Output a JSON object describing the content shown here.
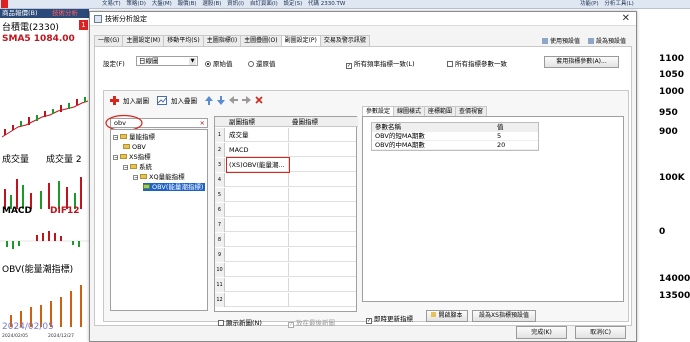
{
  "app": {
    "menu_items": [
      "商品報價(B)",
      "技術分析",
      "文易(T)",
      "策略(D)",
      "大盤(M)",
      "報價(B)",
      "選股(B)",
      "資訊(I)",
      "自訂頁面(I)",
      "設定(S)",
      "代碼 2330.TW"
    ],
    "right_items": [
      "功能(P)",
      "分析工具(L)"
    ]
  },
  "background": {
    "symbol": "台積電(2330)",
    "badge": "1",
    "sma_label": "SMA5 1084.00",
    "volume_label": "成交量",
    "volume_label2": "成交量 2",
    "macd_label": "MACD",
    "dif_label": "DIF12",
    "obv_label": "OBV(能量潮指標)",
    "date_label": "2024/02/05",
    "axis_dates": [
      "2024/02/05",
      "2024/12/27"
    ],
    "right_axis": [
      "1100",
      "1050",
      "1000",
      "950",
      "900",
      "100K",
      "0",
      "14000",
      "13500"
    ]
  },
  "dialog": {
    "title": "技術分析設定",
    "close": "✕",
    "tabs": [
      "一般(G)",
      "主圖設定(M)",
      "移動平均(S)",
      "主圖指標(I)",
      "主圖疊圖(O)",
      "副圖設定(P)",
      "交易及警示訊號"
    ],
    "active_tab": 5,
    "tabs_right": [
      "使用預設值",
      "設為預設值"
    ],
    "setting_label": "設定(F)",
    "setting_value": "日線圖",
    "radio_original": "原始值",
    "radio_restore": "還原值",
    "chk_same_all": "所有頻率指標一致(L)",
    "chk_params": "所有指標參數一致",
    "apply_btn": "套用指標參數(A)...",
    "toolbar": {
      "add_sub": "加入副圖",
      "add_overlay": "加入疊圖"
    },
    "search_value": "obv",
    "tree": [
      {
        "label": "量能指標",
        "level": 0,
        "toggle": "−"
      },
      {
        "label": "OBV",
        "level": 1,
        "toggle": ""
      },
      {
        "label": "XS指標",
        "level": 0,
        "toggle": "−"
      },
      {
        "label": "系統",
        "level": 1,
        "toggle": "−"
      },
      {
        "label": "XQ量能指標",
        "level": 2,
        "toggle": "−"
      },
      {
        "label": "OBV(能量潮指標)",
        "level": 3,
        "toggle": ""
      }
    ],
    "grid": {
      "headers": [
        "副圖指標",
        "疊圖指標"
      ],
      "rows": [
        {
          "num": "1",
          "c1": "成交量",
          "c2": ""
        },
        {
          "num": "2",
          "c1": "MACD",
          "c2": ""
        },
        {
          "num": "3",
          "c1": "(XS)OBV(能量潮...",
          "c2": ""
        },
        {
          "num": "4",
          "c1": "",
          "c2": ""
        },
        {
          "num": "5",
          "c1": "",
          "c2": ""
        },
        {
          "num": "6",
          "c1": "",
          "c2": ""
        },
        {
          "num": "7",
          "c1": "",
          "c2": ""
        },
        {
          "num": "8",
          "c1": "",
          "c2": ""
        },
        {
          "num": "9",
          "c1": "",
          "c2": ""
        },
        {
          "num": "10",
          "c1": "",
          "c2": ""
        },
        {
          "num": "11",
          "c1": "",
          "c2": ""
        },
        {
          "num": "12",
          "c1": "",
          "c2": ""
        }
      ]
    },
    "show_new_label": "顯示新圖(N)",
    "unify_label": "放在最後新圖",
    "param_tabs": [
      "參數設定",
      "線圖樣式",
      "座標範圍",
      "查價視窗"
    ],
    "param_table": {
      "headers": [
        "參數名稱",
        "值"
      ],
      "rows": [
        {
          "name": "OBV的短MA期數",
          "value": "5"
        },
        {
          "name": "OBV的中MA期數",
          "value": "20"
        }
      ]
    },
    "instant_update": "即時更新指標",
    "open_script": "開啟腳本",
    "set_default": "設為XS指標預設值",
    "ok": "完成(K)",
    "cancel": "取消(C)"
  }
}
